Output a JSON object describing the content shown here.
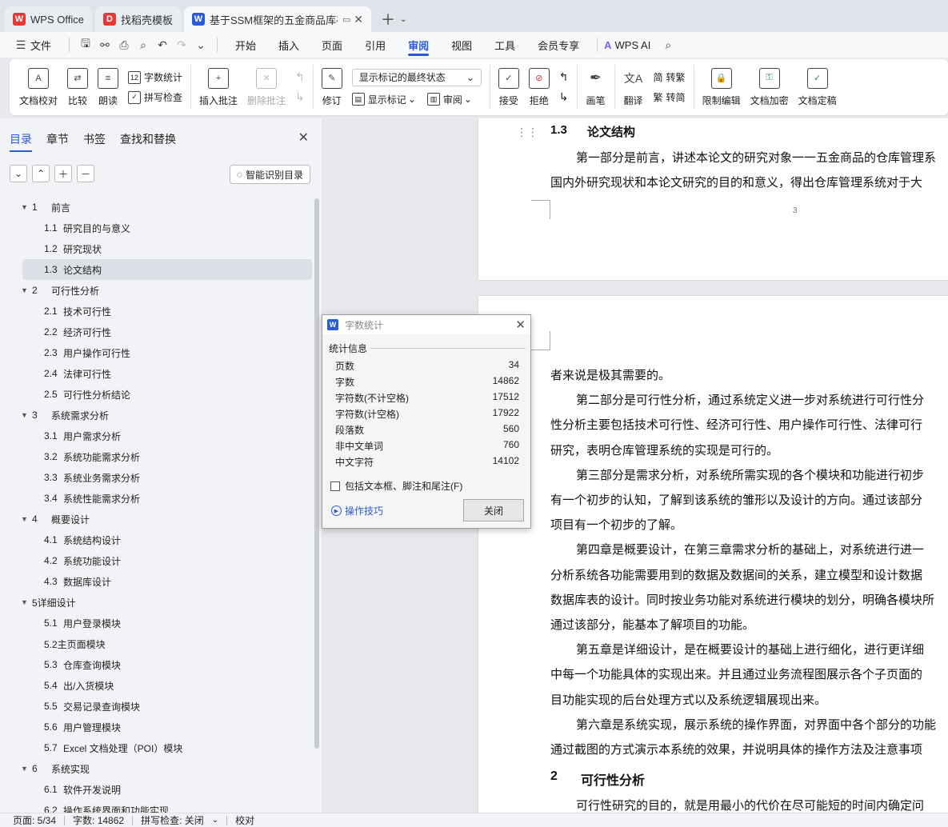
{
  "tabs": [
    {
      "label": "WPS Office",
      "logo": "W",
      "color": "#e53935"
    },
    {
      "label": "找稻壳模板",
      "logo": "D",
      "color": "#e53935"
    },
    {
      "label": "基于SSM框架的五金商品库存",
      "logo": "W",
      "color": "#2b5bd7"
    }
  ],
  "menubar": {
    "file": "文件",
    "items": [
      "开始",
      "插入",
      "页面",
      "引用",
      "审阅",
      "视图",
      "工具",
      "会员专享"
    ],
    "active": "审阅",
    "wps_ai": "WPS AI"
  },
  "ribbon": {
    "doc_check": "文档校对",
    "compare": "比较",
    "read_aloud": "朗读",
    "word_count": "字数统计",
    "spell_check": "拼写检查",
    "insert_comment": "插入批注",
    "delete_comment": "删除批注",
    "revise": "修订",
    "markup_state": "显示标记的最终状态",
    "show_markup": "显示标记",
    "review": "审阅",
    "accept": "接受",
    "reject": "拒绝",
    "pen": "画笔",
    "translate": "翻译",
    "to_traditional": "转繁",
    "to_simplified": "转简",
    "restrict_edit": "限制编辑",
    "encrypt": "文档加密",
    "finalize": "文档定稿"
  },
  "leftpanel": {
    "tabs": [
      "目录",
      "章节",
      "书签",
      "查找和替换"
    ],
    "smart_toc": "智能识别目录",
    "toc": [
      {
        "level": 1,
        "num": "1",
        "text": "前言"
      },
      {
        "level": 2,
        "num": "1.1",
        "text": "研究目的与意义"
      },
      {
        "level": 2,
        "num": "1.2",
        "text": "研究现状"
      },
      {
        "level": 2,
        "num": "1.3",
        "text": "论文结构",
        "selected": true
      },
      {
        "level": 1,
        "num": "2",
        "text": "可行性分析"
      },
      {
        "level": 2,
        "num": "2.1",
        "text": "技术可行性"
      },
      {
        "level": 2,
        "num": "2.2",
        "text": "经济可行性"
      },
      {
        "level": 2,
        "num": "2.3",
        "text": "用户操作可行性"
      },
      {
        "level": 2,
        "num": "2.4",
        "text": "法律可行性"
      },
      {
        "level": 2,
        "num": "2.5",
        "text": "可行性分析结论"
      },
      {
        "level": 1,
        "num": "3",
        "text": "系统需求分析"
      },
      {
        "level": 2,
        "num": "3.1",
        "text": "用户需求分析"
      },
      {
        "level": 2,
        "num": "3.2",
        "text": "系统功能需求分析"
      },
      {
        "level": 2,
        "num": "3.3",
        "text": "系统业务需求分析"
      },
      {
        "level": 2,
        "num": "3.4",
        "text": "系统性能需求分析"
      },
      {
        "level": 1,
        "num": "4",
        "text": "概要设计"
      },
      {
        "level": 2,
        "num": "4.1",
        "text": "系统结构设计"
      },
      {
        "level": 2,
        "num": "4.2",
        "text": "系统功能设计"
      },
      {
        "level": 2,
        "num": "4.3",
        "text": "数据库设计"
      },
      {
        "level": 1,
        "num": "",
        "text": "5详细设计"
      },
      {
        "level": 2,
        "num": "5.1",
        "text": "用户登录模块"
      },
      {
        "level": 2,
        "num": "",
        "text": "5.2主页面模块"
      },
      {
        "level": 2,
        "num": "5.3",
        "text": "仓库查询模块"
      },
      {
        "level": 2,
        "num": "5.4",
        "text": "出/入货模块"
      },
      {
        "level": 2,
        "num": "5.5",
        "text": "交易记录查询模块"
      },
      {
        "level": 2,
        "num": "5.6",
        "text": "用户管理模块"
      },
      {
        "level": 2,
        "num": "5.7",
        "text": "Excel 文档处理（POI）模块"
      },
      {
        "level": 1,
        "num": "6",
        "text": "系统实现"
      },
      {
        "level": 2,
        "num": "6.1",
        "text": "软件开发说明"
      },
      {
        "level": 2,
        "num": "6.2",
        "text": "操作系统界面和功能实现"
      }
    ]
  },
  "document": {
    "page1": {
      "heading_num": "1.3",
      "heading_text": "论文结构",
      "lines": [
        "第一部分是前言，讲述本论文的研究对象一一五金商品的仓库管理系",
        "国内外研究现状和本论文研究的目的和意义，得出仓库管理系统对于大"
      ],
      "page_number": "3"
    },
    "page2": {
      "lines": [
        "者来说是极其需要的。",
        "第二部分是可行性分析，通过系统定义进一步对系统进行可行性分",
        "性分析主要包括技术可行性、经济可行性、用户操作可行性、法律可行",
        "研究，表明仓库管理系统的实现是可行的。",
        "第三部分是需求分析，对系统所需实现的各个模块和功能进行初步",
        "有一个初步的认知，了解到该系统的雏形以及设计的方向。通过该部分",
        "项目有一个初步的了解。",
        "第四章是概要设计，在第三章需求分析的基础上，对系统进行进一",
        "分析系统各功能需要用到的数据及数据间的关系，建立模型和设计数据",
        "数据库表的设计。同时按业务功能对系统进行模块的划分，明确各模块所",
        "通过该部分，能基本了解项目的功能。",
        "第五章是详细设计，是在概要设计的基础上进行细化，进行更详细",
        "中每一个功能具体的实现出来。并且通过业务流程图展示各个子页面的",
        "目功能实现的后台处理方式以及系统逻辑展现出来。",
        "第六章是系统实现，展示系统的操作界面，对界面中各个部分的功能",
        "通过截图的方式演示本系统的效果，并说明具体的操作方法及注意事项"
      ],
      "heading_num": "2",
      "heading_text": "可行性分析",
      "last_line": "可行性研究的目的，就是用最小的代价在尽可能短的时间内确定问"
    }
  },
  "dialog": {
    "title": "字数统计",
    "section": "统计信息",
    "stats": [
      {
        "label": "页数",
        "value": "34"
      },
      {
        "label": "字数",
        "value": "14862"
      },
      {
        "label": "字符数(不计空格)",
        "value": "17512"
      },
      {
        "label": "字符数(计空格)",
        "value": "17922"
      },
      {
        "label": "段落数",
        "value": "560"
      },
      {
        "label": "非中文单词",
        "value": "760"
      },
      {
        "label": "中文字符",
        "value": "14102"
      }
    ],
    "checkbox_label": "包括文本框、脚注和尾注(F)",
    "tip": "操作技巧",
    "close": "关闭"
  },
  "statusbar": {
    "page": "页面: 5/34",
    "words": "字数: 14862",
    "spell": "拼写检查: 关闭",
    "proof": "校对"
  }
}
